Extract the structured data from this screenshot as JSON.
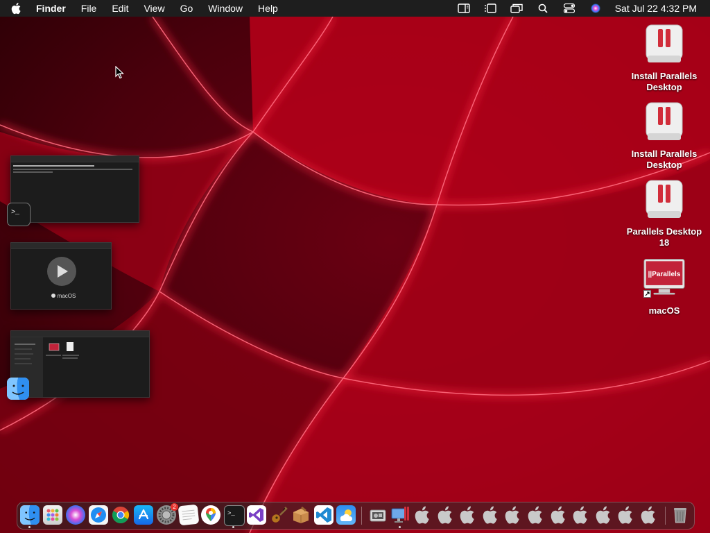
{
  "menubar": {
    "app_name": "Finder",
    "menus": [
      "File",
      "Edit",
      "View",
      "Go",
      "Window",
      "Help"
    ],
    "status_icons": [
      "sidebar-icon",
      "stage-manager-icon",
      "screen-mirroring-icon",
      "spotlight-icon",
      "control-center-icon",
      "siri-icon"
    ],
    "clock": "Sat Jul 22  4:32 PM"
  },
  "desktop": {
    "icons": [
      {
        "label": "Install Parallels Desktop",
        "icon": "parallels-installer-icon"
      },
      {
        "label": "Install Parallels Desktop",
        "icon": "parallels-installer-icon"
      },
      {
        "label": "Parallels Desktop 18",
        "icon": "parallels-installer-icon"
      },
      {
        "label": "macOS",
        "icon": "parallels-vm-icon",
        "logo_text": "||Parallels"
      }
    ]
  },
  "stage_manager": {
    "windows": [
      {
        "app": "Terminal",
        "icon": "terminal-icon"
      },
      {
        "app": "macOS",
        "icon": "play-icon",
        "caption": "macOS"
      },
      {
        "app": "Finder",
        "icon": "finder-icon"
      }
    ]
  },
  "dock": {
    "apps": [
      {
        "name": "Finder",
        "icon": "finder-icon",
        "running": true
      },
      {
        "name": "Launchpad",
        "icon": "launchpad-icon",
        "running": false
      },
      {
        "name": "Siri",
        "icon": "siri-icon",
        "running": false
      },
      {
        "name": "Safari",
        "icon": "safari-icon",
        "running": false
      },
      {
        "name": "Google Chrome",
        "icon": "chrome-icon",
        "running": false
      },
      {
        "name": "App Store",
        "icon": "app-store-icon",
        "running": false
      },
      {
        "name": "System Settings",
        "icon": "system-settings-icon",
        "running": false,
        "badge": "2"
      },
      {
        "name": "TextEdit",
        "icon": "textedit-icon",
        "running": false
      },
      {
        "name": "Google Maps",
        "icon": "maps-icon",
        "running": false
      },
      {
        "name": "Terminal",
        "icon": "terminal-icon",
        "running": true
      },
      {
        "name": "Visual Studio",
        "icon": "visual-studio-icon",
        "running": false
      },
      {
        "name": "Instruments",
        "icon": "guitar-icon",
        "running": false
      },
      {
        "name": "Archive Utility",
        "icon": "archive-icon",
        "running": false
      },
      {
        "name": "VS Code",
        "icon": "vscode-icon",
        "running": false
      },
      {
        "name": "Weather",
        "icon": "weather-icon",
        "running": false
      },
      {
        "name": "Boot Camp",
        "icon": "bootcamp-icon",
        "running": false
      },
      {
        "name": "Parallels Desktop",
        "icon": "parallels-dock-icon",
        "running": true
      },
      {
        "name": "Apple 1",
        "icon": "apple-icon"
      },
      {
        "name": "Apple 2",
        "icon": "apple-icon"
      },
      {
        "name": "Apple 3",
        "icon": "apple-icon"
      },
      {
        "name": "Apple 4",
        "icon": "apple-icon"
      },
      {
        "name": "Apple 5",
        "icon": "apple-icon"
      },
      {
        "name": "Apple 6",
        "icon": "apple-icon"
      },
      {
        "name": "Apple 7",
        "icon": "apple-icon"
      },
      {
        "name": "Apple 8",
        "icon": "apple-icon"
      },
      {
        "name": "Apple 9",
        "icon": "apple-icon"
      },
      {
        "name": "Apple 10",
        "icon": "apple-icon"
      },
      {
        "name": "Apple 11",
        "icon": "apple-icon"
      },
      {
        "name": "Trash",
        "icon": "trash-icon",
        "running": false
      }
    ]
  },
  "colors": {
    "wallpaper_dark": "#3a0008",
    "wallpaper_red": "#e8102e",
    "menubar_bg": "#1e1e1e",
    "parallels_red": "#d12d3a"
  }
}
